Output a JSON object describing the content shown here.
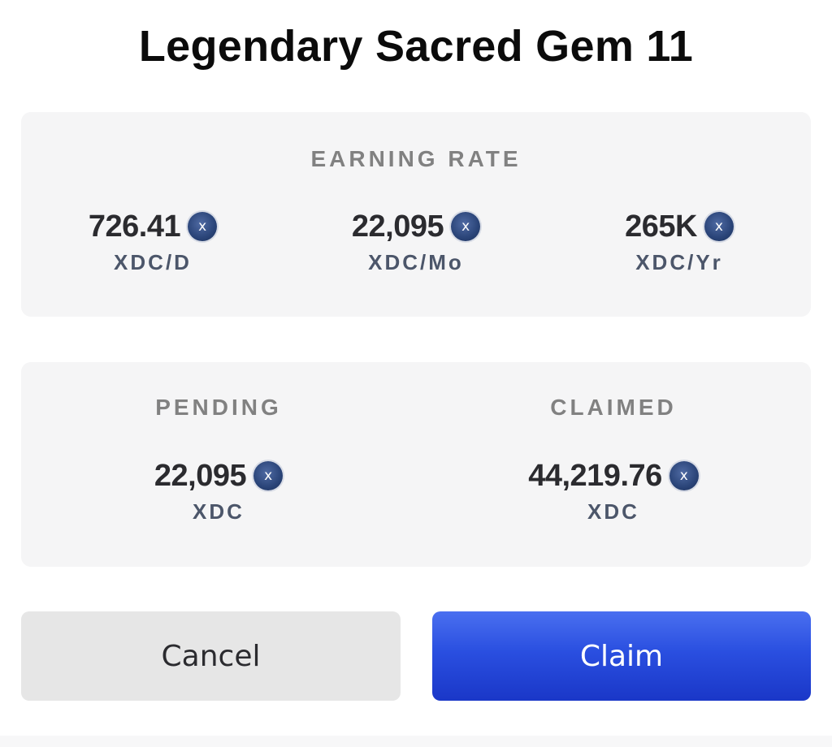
{
  "title": "Legendary Sacred Gem 11",
  "earning_rate": {
    "label": "EARNING RATE",
    "items": [
      {
        "value": "726.41",
        "unit": "XDC/D"
      },
      {
        "value": "22,095",
        "unit": "XDC/Mo"
      },
      {
        "value": "265K",
        "unit": "XDC/Yr"
      }
    ]
  },
  "pending": {
    "label": "PENDING",
    "value": "22,095",
    "unit": "XDC"
  },
  "claimed": {
    "label": "CLAIMED",
    "value": "44,219.76",
    "unit": "XDC"
  },
  "coin_icon": {
    "name": "xdc-coin-icon",
    "glyph": "x",
    "color": "#2a4478"
  },
  "buttons": {
    "cancel_label": "Cancel",
    "claim_label": "Claim"
  },
  "colors": {
    "claim_button": "#2a4fe0",
    "cancel_button": "#e6e6e6",
    "card_background": "#f5f5f6"
  }
}
